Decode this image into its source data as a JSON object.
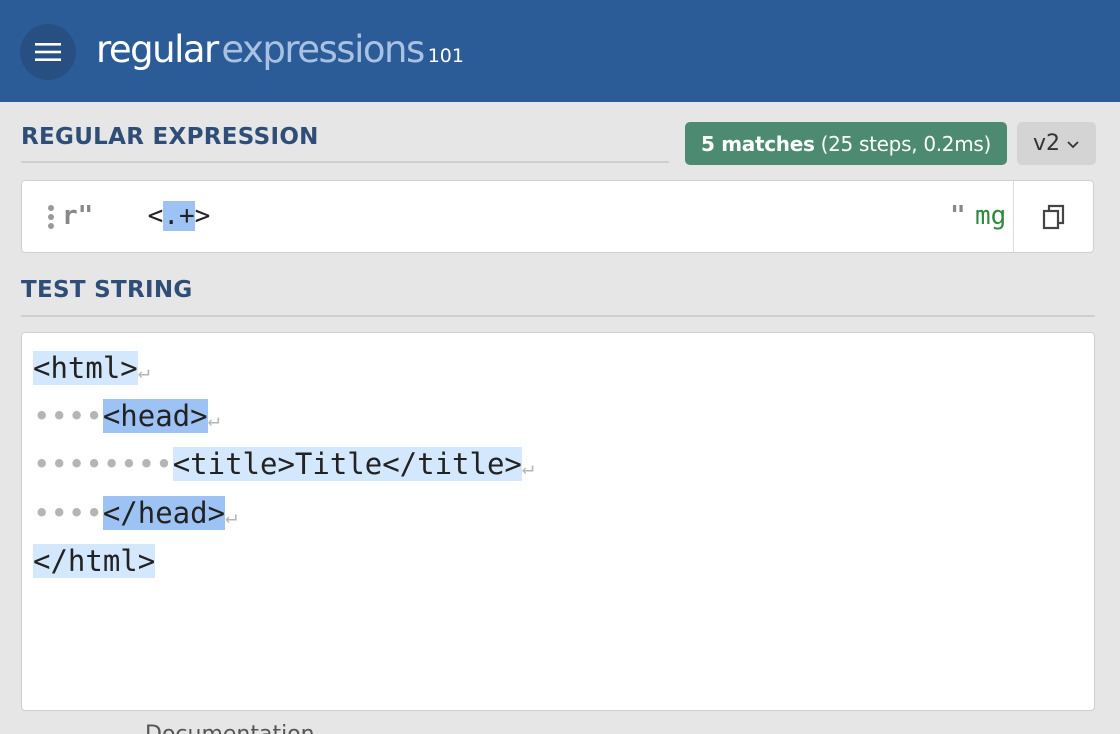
{
  "header": {
    "logo_word1": "regular",
    "logo_word2": "expressions",
    "logo_suffix": "101"
  },
  "regex_section": {
    "title": "REGULAR EXPRESSION",
    "match_count": "5 matches",
    "match_details": "(25 steps, 0.2ms)",
    "version": "v2",
    "delimiter_open": "r\"",
    "pattern_pre": " <",
    "pattern_highlight": ".+",
    "pattern_post": ">",
    "delimiter_close": "\"",
    "flags": "mg"
  },
  "test_section": {
    "title": "TEST STRING",
    "lines": [
      {
        "indent": "",
        "text": "<html>",
        "newline": "↵"
      },
      {
        "indent": "••••",
        "text": "<head>",
        "newline": "↵"
      },
      {
        "indent": "••••••••",
        "text": "<title>Title</title>",
        "newline": "↵"
      },
      {
        "indent": "••••",
        "text": "</head>",
        "newline": "↵"
      },
      {
        "indent": "",
        "text": "</html>",
        "newline": ""
      }
    ]
  },
  "colors": {
    "header_bg": "#2c5c97",
    "match_badge_bg": "#4d8a72",
    "match_light": "#d4e8fd",
    "match_dark": "#9dc3f5",
    "flags_green": "#2d8a3e"
  },
  "icons": {
    "menu": "hamburger-icon",
    "chevron": "chevron-down-icon",
    "copy": "copy-icon",
    "drag": "drag-handle-icon"
  },
  "clipped_text": "Documentation"
}
